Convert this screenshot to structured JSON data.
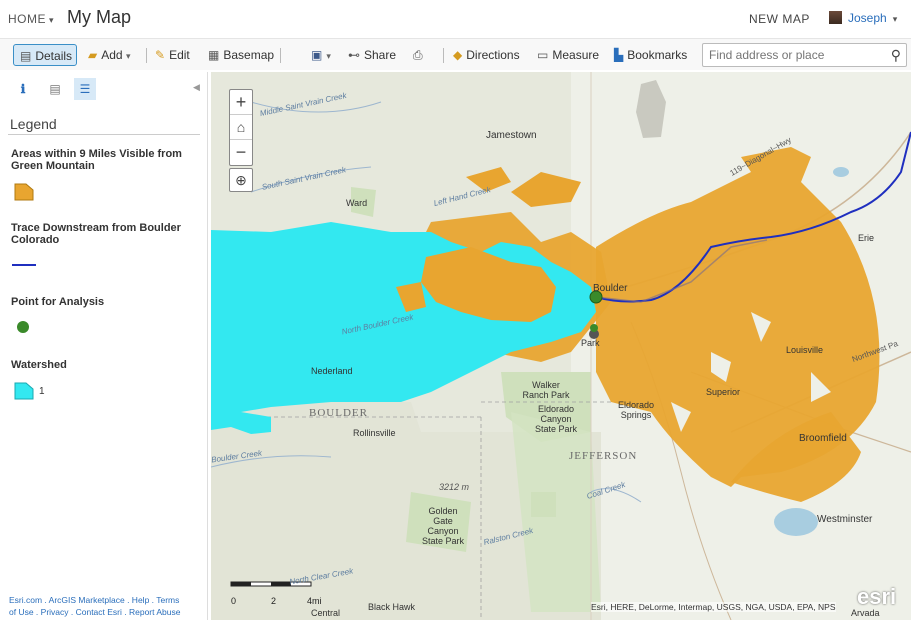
{
  "header": {
    "home_label": "HOME",
    "map_title": "My Map",
    "new_map_label": "NEW MAP",
    "user_name": "Joseph"
  },
  "toolbar": {
    "details": "Details",
    "add": "Add",
    "edit": "Edit",
    "basemap": "Basemap",
    "share": "Share",
    "directions": "Directions",
    "measure": "Measure",
    "bookmarks": "Bookmarks",
    "search_placeholder": "Find address or place"
  },
  "legend": {
    "title": "Legend",
    "items": [
      {
        "label": "Areas within 9 Miles Visible from Green Mountain",
        "color": "#e8a530"
      },
      {
        "label": "Trace Downstream from Boulder Colorado",
        "color": "#1f2fbf"
      },
      {
        "label": "Point for Analysis",
        "color": "#3a8a2a"
      },
      {
        "label": "Watershed",
        "sub": "1",
        "color": "#33e8f0"
      }
    ]
  },
  "footer": {
    "line1": "Esri.com . ArcGIS Marketplace . Help . Terms",
    "line2": "of Use . Privacy . Contact Esri . Report Abuse"
  },
  "map": {
    "attribution": "Esri, HERE, DeLorme, Intermap, USGS, NGA, USDA, EPA, NPS",
    "esri_logo": "esri",
    "scale": {
      "zero": "0",
      "two": "2",
      "four": "4mi"
    },
    "places": {
      "jamestown": "Jamestown",
      "ward": "Ward",
      "boulder": "Boulder",
      "nederland": "Nederland",
      "walker_ranch": "Walker Ranch Park",
      "eldorado_canyon": "Eldorado Canyon State Park",
      "eldorado_springs": "Eldorado Springs",
      "superior": "Superior",
      "louisville": "Louisville",
      "broomfield": "Broomfield",
      "westminster": "Westminster",
      "erie": "Erie",
      "rollinsville": "Rollinsville",
      "golden_gate": "Golden Gate Canyon State Park",
      "black_hawk": "Black Hawk",
      "central": "Central",
      "arvada": "Arvada",
      "boulder_county": "BOULDER",
      "jefferson_county": "JEFFERSON",
      "elevation": "3212 m",
      "middle_saint_vrain": "Middle Saint Vrain Creek",
      "south_saint_vrain": "South Saint Vrain Creek",
      "left_hand": "Left Hand Creek",
      "north_boulder": "North Boulder Creek",
      "boulder_creek": "Boulder Creek",
      "coal_creek": "Coal Creek",
      "ralston_creek": "Ralston Creek",
      "north_clear": "North Clear Creek",
      "diagonal_hwy": "119~Diagonal~Hwy",
      "northwest_pkwy": "Northwest Pa",
      "park_partial": "Park"
    }
  }
}
